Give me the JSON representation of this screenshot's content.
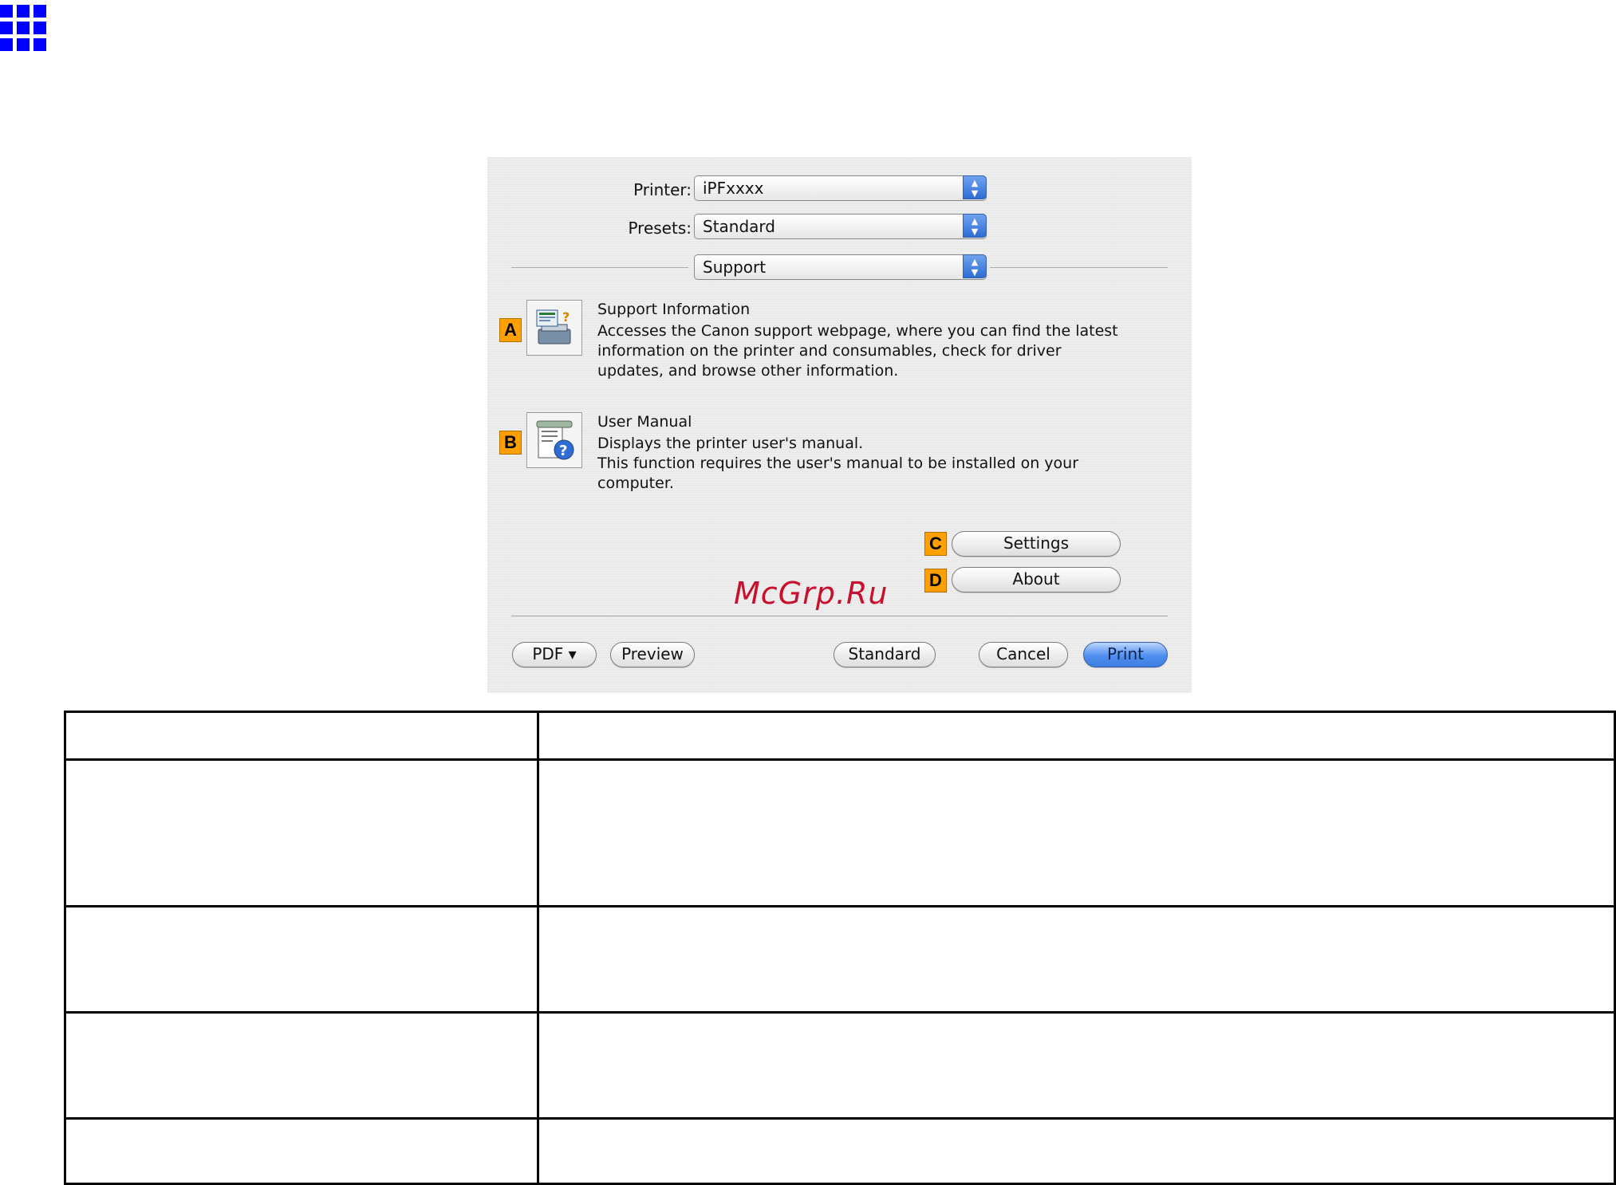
{
  "dialog": {
    "printer": {
      "label": "Printer:",
      "value": "iPFxxxx"
    },
    "presets": {
      "label": "Presets:",
      "value": "Standard"
    },
    "panel": {
      "value": "Support"
    },
    "items": [
      {
        "badge": "A",
        "icon": "support-info-icon",
        "title": "Support Information",
        "lines": [
          "Accesses the Canon support webpage, where you can find the latest",
          "information on the printer and consumables, check for driver",
          "updates, and browse other information."
        ]
      },
      {
        "badge": "B",
        "icon": "user-manual-icon",
        "title": "User Manual",
        "lines": [
          "Displays the printer user's manual.",
          "This function requires the user's manual to be installed on your",
          "computer."
        ]
      }
    ],
    "settings_badge": "C",
    "settings_label": "Settings",
    "about_badge": "D",
    "about_label": "About",
    "footer": {
      "pdf": "PDF ▾",
      "preview": "Preview",
      "standard": "Standard",
      "cancel": "Cancel",
      "print": "Print"
    }
  },
  "watermark": "McGrp.Ru",
  "colors": {
    "badge": "#ff9f00",
    "primary_button": "#4f8ef0",
    "grid_icon": "#0000ff",
    "watermark": "#c8102e"
  },
  "table": {
    "rows": [
      [
        "",
        ""
      ],
      [
        "",
        ""
      ],
      [
        "",
        ""
      ],
      [
        "",
        ""
      ],
      [
        "",
        ""
      ]
    ]
  }
}
